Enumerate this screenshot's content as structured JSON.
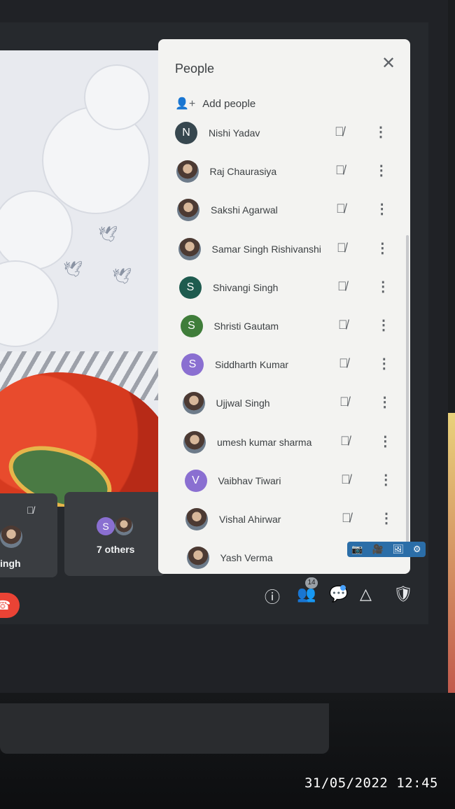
{
  "panel": {
    "title": "People",
    "close_icon": "✕",
    "add_label": "Add people",
    "participants": [
      {
        "name": "Nishi Yadav",
        "initial": "N",
        "color": "#37474f",
        "photo": false
      },
      {
        "name": "Raj Chaurasiya",
        "initial": "",
        "color": "",
        "photo": true
      },
      {
        "name": "Sakshi Agarwal",
        "initial": "",
        "color": "",
        "photo": true
      },
      {
        "name": "Samar Singh Rishivanshi",
        "initial": "",
        "color": "",
        "photo": true
      },
      {
        "name": "Shivangi Singh",
        "initial": "S",
        "color": "#1e5b4f",
        "photo": false
      },
      {
        "name": "Shristi Gautam",
        "initial": "S",
        "color": "#3f7d3a",
        "photo": false
      },
      {
        "name": "Siddharth Kumar",
        "initial": "S",
        "color": "#8a6fd1",
        "photo": false
      },
      {
        "name": "Ujjwal Singh",
        "initial": "",
        "color": "",
        "photo": true
      },
      {
        "name": "umesh kumar sharma",
        "initial": "",
        "color": "",
        "photo": true
      },
      {
        "name": "Vaibhav Tiwari",
        "initial": "V",
        "color": "#8a6fd1",
        "photo": false
      },
      {
        "name": "Vishal Ahirwar",
        "initial": "",
        "color": "",
        "photo": true
      },
      {
        "name": "Yash Verma",
        "initial": "",
        "color": "",
        "photo": true
      }
    ]
  },
  "tiles": {
    "left_name": "ingh",
    "others_label": "7 others",
    "others_initial": "S"
  },
  "controls": {
    "people_count": "14"
  },
  "timestamp": "31/05/2022 12:45"
}
